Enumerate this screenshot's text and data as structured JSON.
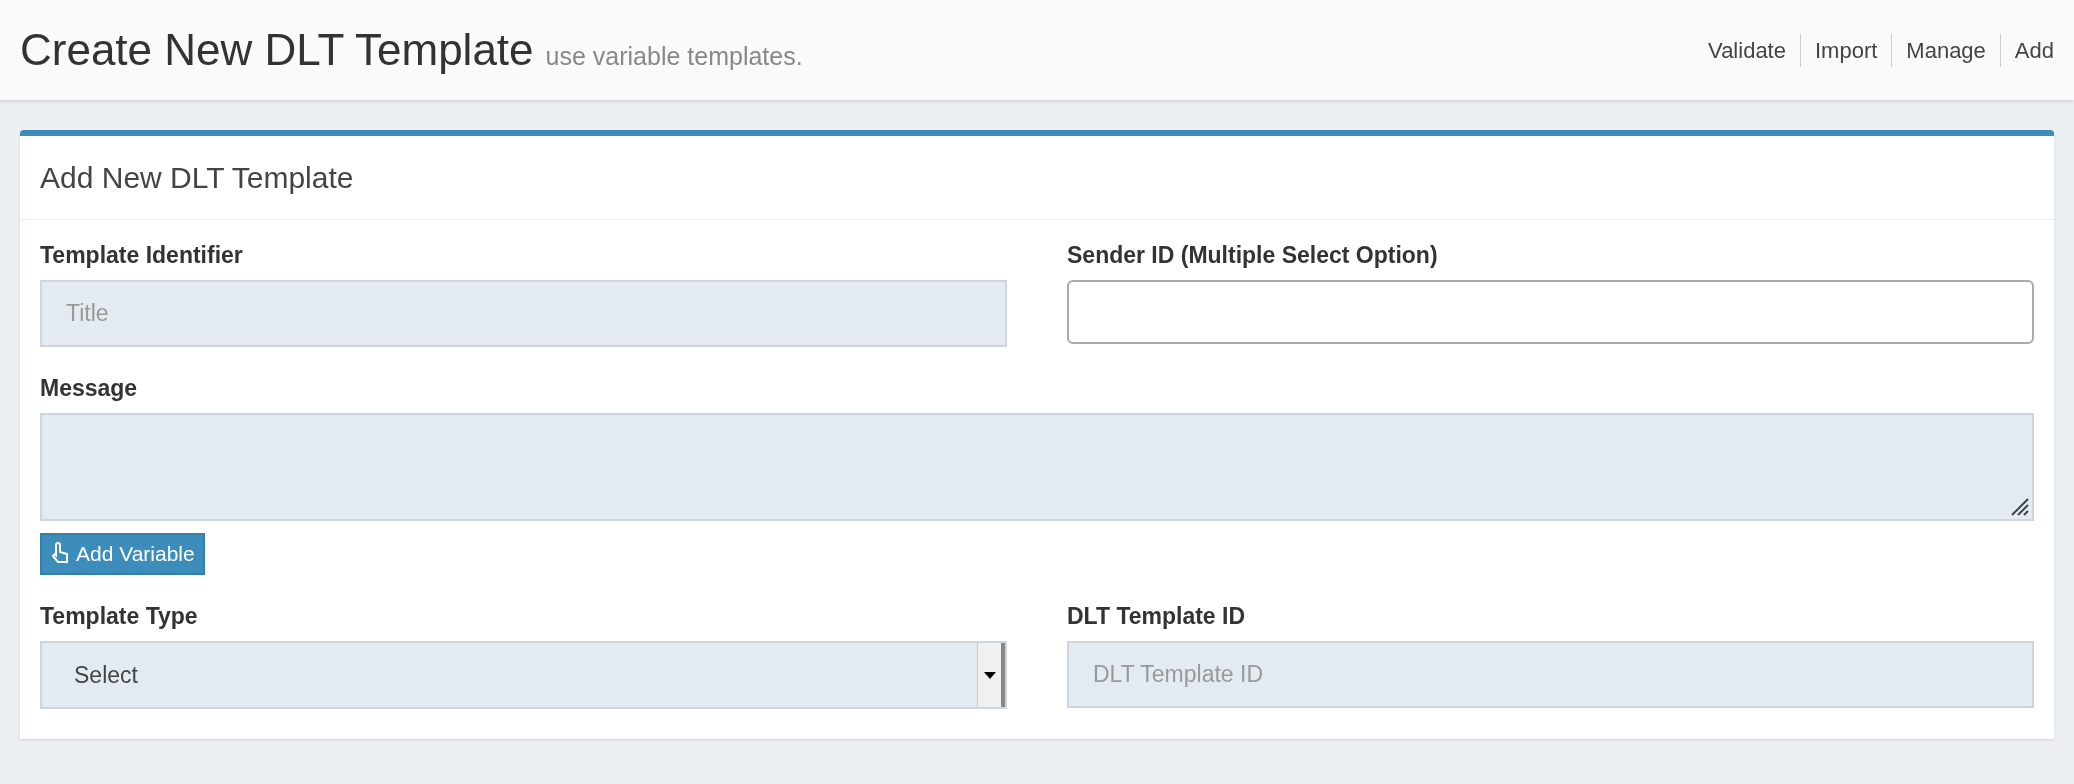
{
  "header": {
    "title": "Create New DLT Template",
    "subtitle": "use variable templates.",
    "nav": [
      "Validate",
      "Import",
      "Manage",
      "Add"
    ]
  },
  "card": {
    "title": "Add New DLT Template",
    "rows": [
      [
        {
          "kind": "input",
          "label": "Template Identifier",
          "placeholder": "Title"
        },
        {
          "kind": "multiselect",
          "label": "Sender ID (Multiple Select Option)"
        }
      ],
      [
        {
          "kind": "textarea",
          "label": "Message",
          "button": "Add Variable"
        }
      ],
      [
        {
          "kind": "select",
          "label": "Template Type",
          "value": "Select"
        },
        {
          "kind": "input",
          "label": "DLT Template ID",
          "placeholder": "DLT Template ID"
        }
      ]
    ]
  }
}
